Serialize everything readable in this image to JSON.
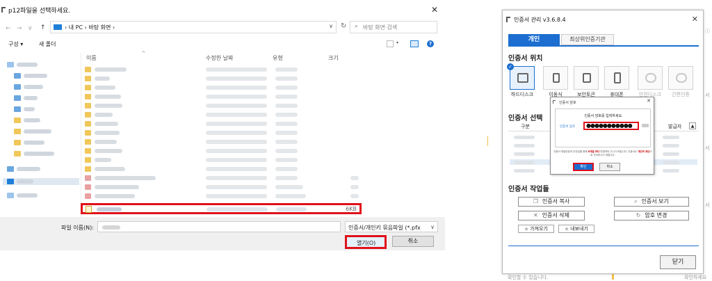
{
  "file_dialog": {
    "title": "p12파일을 선택하세요.",
    "close_glyph": "✕",
    "nav": {
      "back": "←",
      "forward": "→",
      "dropdown": "∨",
      "up": "↑"
    },
    "address": {
      "crumbs": "›  내 PC  ›  바탕 화면  ›",
      "dropdown": "∨",
      "refresh": "↻"
    },
    "search_placeholder": "바탕 화면 검색",
    "toolbar": {
      "organize": "구성 ▾",
      "new_folder": "새 폴더"
    },
    "columns": {
      "name": "이름",
      "date": "수정한 날짜",
      "type": "유형",
      "size": "크기",
      "sort_caret": "^"
    },
    "selected_file_size": "6KB",
    "filename_label": "파일 이름(N):",
    "filetype_value": "인증서/개인키 묶음파일 (*.pfx",
    "filetype_dropdown": "∨",
    "open_button": "열기(O)",
    "cancel_button": "취소"
  },
  "cert_manager": {
    "title": "인증서 관리 v3.6.8.4",
    "close_glyph": "✕",
    "tabs": [
      "개인",
      "최상위인증기관"
    ],
    "section_location": "인증서 위치",
    "locations": [
      {
        "label": "하드디스크",
        "state": "selected",
        "icon": "monitor-icon"
      },
      {
        "label": "이동식",
        "state": "normal",
        "icon": "usb-icon"
      },
      {
        "label": "보안토큰",
        "state": "normal",
        "icon": "lock-icon"
      },
      {
        "label": "휴대폰",
        "state": "normal",
        "icon": "phone-icon"
      },
      {
        "label": "안전디스크",
        "state": "disabled",
        "icon": "disk-icon"
      },
      {
        "label": "간편인증",
        "state": "disabled",
        "icon": "badge-icon"
      }
    ],
    "section_select": "인증서 선택",
    "table_headers": {
      "col1": "구분",
      "col2": "발급자"
    },
    "section_tasks": "인증서 작업들",
    "task_buttons": {
      "copy": "인증서 복사",
      "view": "인증서 보기",
      "delete": "인증서 삭제",
      "change_pw": "암호 변경",
      "import": "가져오기",
      "export": "내보내기"
    },
    "close_button": "닫기"
  },
  "password_dialog": {
    "title": "인증서 암호",
    "close_glyph": "✕",
    "prompt": "인증서 암호를 입력하세요.",
    "field_label": "인증서 암호",
    "masked_value": "●●●●●●●●●●●",
    "note_parts": [
      "인증서 비밀번호의 안전성을 위해 ",
      "6개월 마다",
      " 변경하여 주시기 바랍니다. 인증서는 ",
      "개인의 재산",
      "으로 관리하시기 바랍니다."
    ],
    "ok_button": "확인",
    "cancel_button": "취소"
  },
  "right_edge_fragments": {
    "bottom_text": "확인할 수 있습니다.",
    "bottom_right": "확인하세요"
  },
  "colors": {
    "highlight_red": "#e0101a",
    "accent_blue": "#1c6ed0",
    "folder_yellow": "#f0c75a"
  }
}
